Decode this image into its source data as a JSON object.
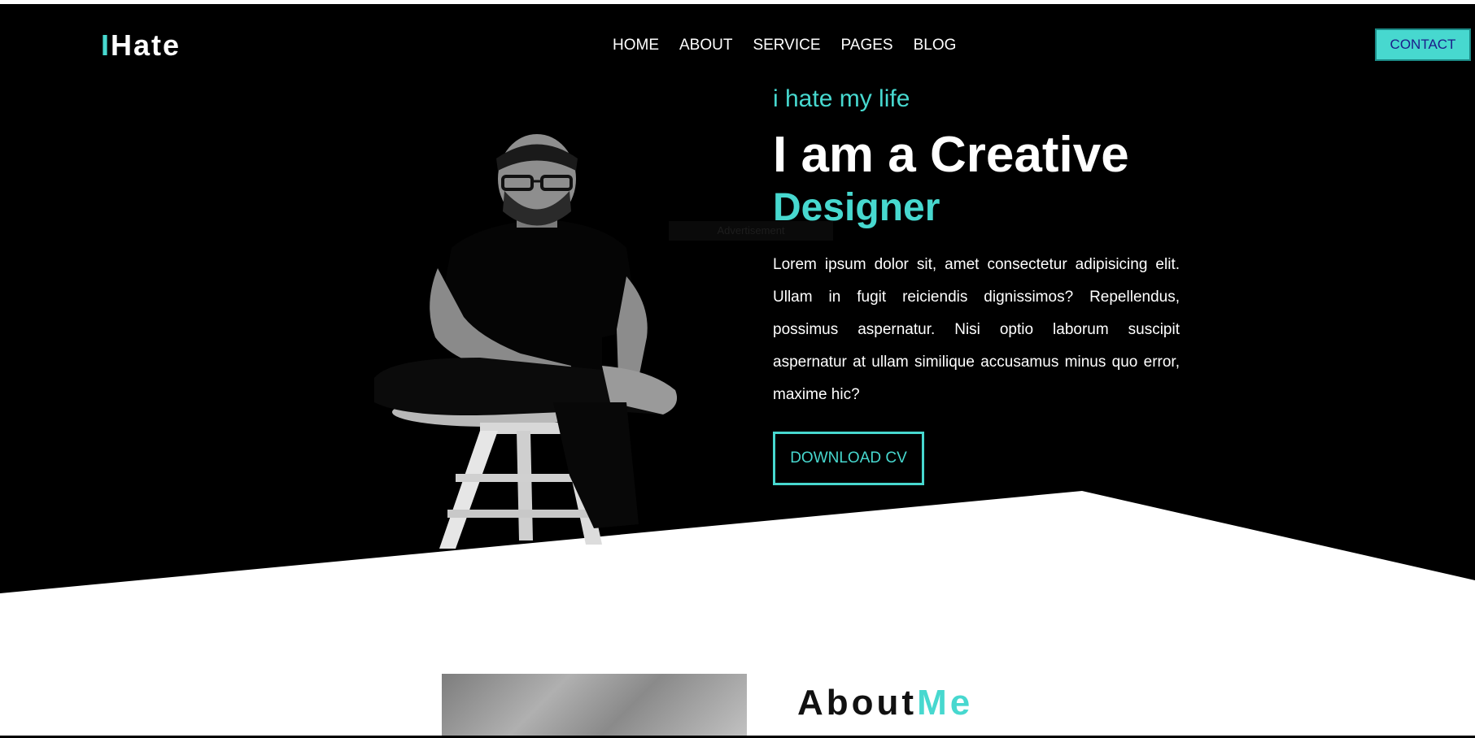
{
  "nav": {
    "logo_prefix": "I",
    "logo_rest": "Hate",
    "items": [
      "HOME",
      "ABOUT",
      "SERVICE",
      "PAGES",
      "BLOG"
    ],
    "contact_label": "CONTACT"
  },
  "hero": {
    "tagline": "i hate my life",
    "headline": "I am a Creative",
    "headline_accent": "Designer",
    "intro": "Lorem ipsum dolor sit, amet consectetur adipisicing elit. Ullam in fugit reiciendis dignissimos? Repellendus, possimus aspernatur. Nisi optio laborum suscipit aspernatur at ullam similique accusamus minus quo error, maxime hic?",
    "cta_label": "DOWNLOAD CV",
    "photo_icon": "person-on-stool-image",
    "ghost_caption": "Advertisement"
  },
  "about": {
    "title": "About",
    "title_accent": "Me"
  },
  "colors": {
    "accent": "#47d8cf",
    "background_dark": "#000000",
    "text_light": "#ffffff"
  }
}
